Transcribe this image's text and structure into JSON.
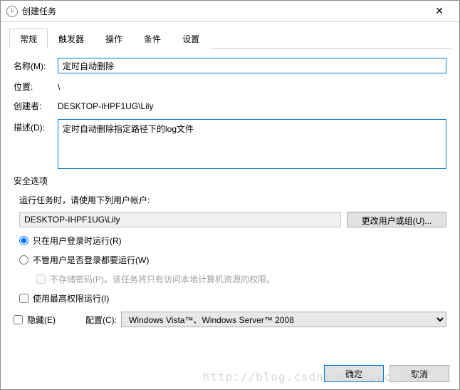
{
  "window": {
    "title": "创建任务"
  },
  "tabs": {
    "general": "常规",
    "triggers": "触发器",
    "actions": "操作",
    "conditions": "条件",
    "settings": "设置"
  },
  "form": {
    "name_label": "名称(M):",
    "name_value": "定时自动删除",
    "location_label": "位置:",
    "location_value": "\\",
    "author_label": "创建者:",
    "author_value": "DESKTOP-IHPF1UG\\Lily",
    "desc_label": "描述(D):",
    "desc_value": "定时自动删除指定路径下的log文件"
  },
  "security": {
    "section": "安全选项",
    "run_as_label": "运行任务时，请使用下列用户帐户:",
    "user": "DESKTOP-IHPF1UG\\Lily",
    "change_user_btn": "更改用户或组(U)...",
    "radio_logged_on": "只在用户登录时运行(R)",
    "radio_any": "不管用户是否登录都要运行(W)",
    "no_store_pwd": "不存储密码(P)。该任务将只有访问本地计算机资源的权限。",
    "highest_priv": "使用最高权限运行(I)"
  },
  "bottom": {
    "hidden": "隐藏(E)",
    "config_label": "配置(C):",
    "config_value": "Windows Vista™、Windows Server™ 2008"
  },
  "buttons": {
    "ok": "确定",
    "cancel": "取消"
  },
  "watermark": "http://blog.csdn.net/xiao_lxl"
}
